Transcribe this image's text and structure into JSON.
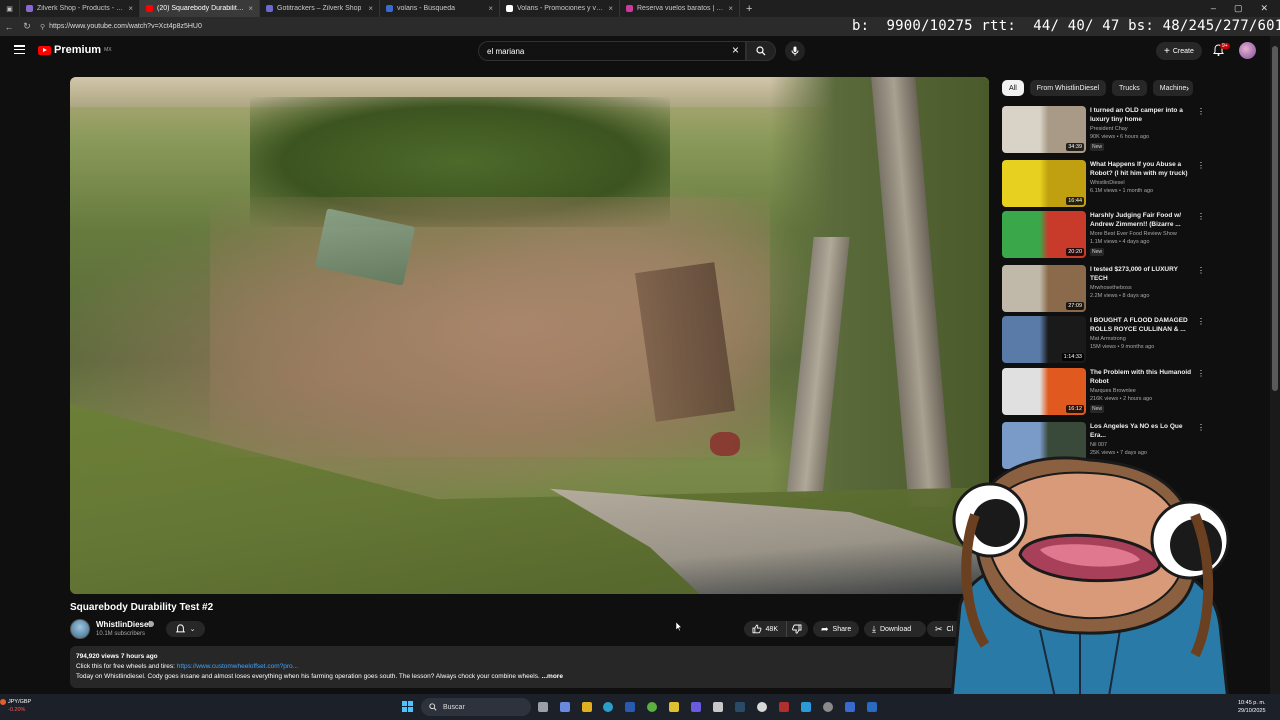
{
  "browser": {
    "tabs": [
      {
        "label": "Zilverk Shop - Products - Gotitra...",
        "color": "#8a6ad0"
      },
      {
        "label": "(20) Squarebody Durability Test",
        "color": "#ff0000"
      },
      {
        "label": "Gotitrackers – Zilverk Shop",
        "color": "#6a6ad0"
      },
      {
        "label": "volaris - Búsqueda",
        "color": "#3a6ad0"
      },
      {
        "label": "Volaris - Promociones y vuelos m...",
        "color": "#ffffff"
      },
      {
        "label": "Reserva vuelos baratos | Volaris",
        "color": "#cc3aa0"
      }
    ],
    "new_tab_symbol": "+",
    "url": "https://www.youtube.com/watch?v=Xct4p8z5HU0"
  },
  "stats_overlay": "b:  9900/10275 rtt:  44/ 40/ 47 bs: 48/245/277/601",
  "yt": {
    "logo_text": "Premium",
    "logo_sup": "MX",
    "search_value": "el mariana",
    "create_label": "Create",
    "notifications": "9+"
  },
  "video": {
    "title": "Squarebody Durability Test #2",
    "channel": "WhistlinDiesel",
    "subscribers": "10.1M subscribers",
    "likes": "48K",
    "share_label": "Share",
    "download_label": "Download",
    "clip_label": "Cl",
    "views_time": "794,920 views  7 hours ago",
    "desc_line1": "Click this for free wheels and tires:",
    "desc_link": "https://www.customwheeloffset.com?pro...",
    "desc_line2": "Today on Whistlindiesel. Cody goes insane and almost loses everything when his farming operation goes south. The lesson? Always chock your combine wheels.",
    "more_label": "...more"
  },
  "chips": [
    "All",
    "From WhistlinDiesel",
    "Trucks",
    "Machine"
  ],
  "recommendations": [
    {
      "title": "I turned an OLD camper into a luxury tiny home",
      "channel": "President Chay",
      "meta": "90K views • 6 hours ago",
      "badge": "New",
      "duration": "34:39",
      "thumb_a": "#d9d2c6",
      "thumb_b": "#a89a86"
    },
    {
      "title": "What Happens If you Abuse a Robot? (I hit him with my truck)",
      "channel": "WhistlinDiesel",
      "meta": "6.1M views • 1 month ago",
      "badge": "",
      "duration": "16:44",
      "thumb_a": "#e8d020",
      "thumb_b": "#c0a010"
    },
    {
      "title": "Harshly Judging Fair Food w/ Andrew Zimmern!! (Bizarre ...",
      "channel": "More Best Ever Food Review Show",
      "meta": "1.1M views • 4 days ago",
      "badge": "New",
      "duration": "20:20",
      "thumb_a": "#3aa84a",
      "thumb_b": "#c83a2a"
    },
    {
      "title": "I tested $273,000 of LUXURY TECH",
      "channel": "Mrwhosetheboss",
      "meta": "2.2M views • 8 days ago",
      "badge": "",
      "duration": "27:09",
      "thumb_a": "#c0b8a8",
      "thumb_b": "#8a6a4a"
    },
    {
      "title": "I BOUGHT A FLOOD DAMAGED ROLLS ROYCE CULLINAN & ...",
      "channel": "Mat Armstrong",
      "meta": "15M views • 9 months ago",
      "badge": "",
      "duration": "1:14:33",
      "thumb_a": "#5a7aa8",
      "thumb_b": "#1a1a1a"
    },
    {
      "title": "The Problem with this Humanoid Robot",
      "channel": "Marques Brownlee",
      "meta": "216K views • 2 hours ago",
      "badge": "New",
      "duration": "16:12",
      "thumb_a": "#e0e0e0",
      "thumb_b": "#e05a20"
    },
    {
      "title": "Los Angeles Ya NO es Lo Que Era...",
      "channel": "Nil 007",
      "meta": "25K views • 7 days ago",
      "badge": "",
      "duration": "",
      "thumb_a": "#7a9ac8",
      "thumb_b": "#3a4a3a"
    }
  ],
  "taskbar": {
    "ticker_pair": "JPY/GBP",
    "ticker_change": "-0.20%",
    "search_placeholder": "Buscar",
    "time": "10:45 p. m.",
    "date": "29/10/2025"
  }
}
